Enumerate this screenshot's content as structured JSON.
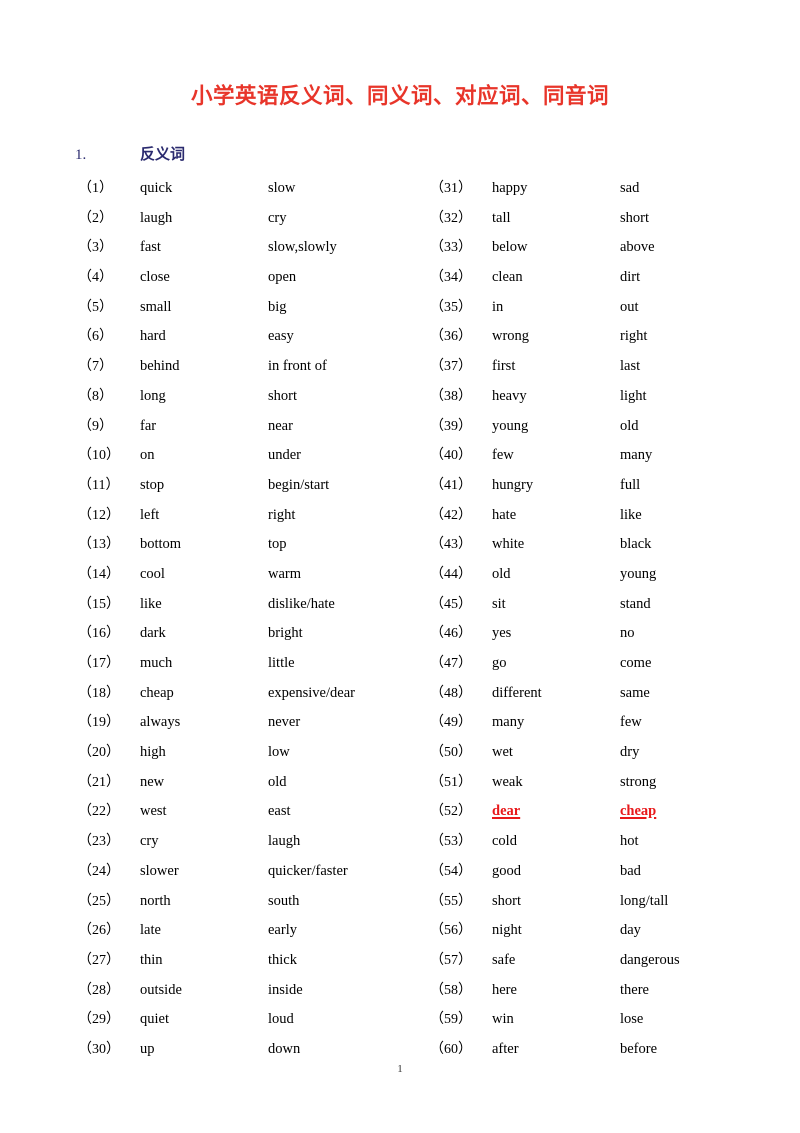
{
  "document": {
    "title": "小学英语反义词、同义词、对应词、同音词",
    "title_color": "#e8352a",
    "page_number": "1"
  },
  "section": {
    "number": "1.",
    "label": "反义词",
    "color": "#2a2a6e"
  },
  "highlight": {
    "color": "#e8191b"
  },
  "antonyms": {
    "left_column": [
      {
        "idx": "（1）",
        "word": "quick",
        "opposite": "slow"
      },
      {
        "idx": "（2）",
        "word": "laugh",
        "opposite": "cry"
      },
      {
        "idx": "（3）",
        "word": "fast",
        "opposite": "slow,slowly"
      },
      {
        "idx": "（4）",
        "word": "close",
        "opposite": "open"
      },
      {
        "idx": "（5）",
        "word": "small",
        "opposite": "big"
      },
      {
        "idx": "（6）",
        "word": "hard",
        "opposite": "easy"
      },
      {
        "idx": "（7）",
        "word": "behind",
        "opposite": "in front of"
      },
      {
        "idx": "（8）",
        "word": "long",
        "opposite": "short"
      },
      {
        "idx": "（9）",
        "word": "far",
        "opposite": "near"
      },
      {
        "idx": "（10）",
        "word": "on",
        "opposite": "under"
      },
      {
        "idx": "（11）",
        "word": "stop",
        "opposite": "begin/start"
      },
      {
        "idx": "（12）",
        "word": "left",
        "opposite": "right"
      },
      {
        "idx": "（13）",
        "word": "bottom",
        "opposite": "top"
      },
      {
        "idx": "（14）",
        "word": "cool",
        "opposite": "warm"
      },
      {
        "idx": "（15）",
        "word": "like",
        "opposite": "dislike/hate"
      },
      {
        "idx": "（16）",
        "word": "dark",
        "opposite": "bright"
      },
      {
        "idx": "（17）",
        "word": "much",
        "opposite": "little"
      },
      {
        "idx": "（18）",
        "word": "cheap",
        "opposite": "expensive/dear"
      },
      {
        "idx": "（19）",
        "word": "always",
        "opposite": "never"
      },
      {
        "idx": "（20）",
        "word": "high",
        "opposite": "low"
      },
      {
        "idx": "（21）",
        "word": "new",
        "opposite": "old"
      },
      {
        "idx": "（22）",
        "word": "west",
        "opposite": "east"
      },
      {
        "idx": "（23）",
        "word": "cry",
        "opposite": "laugh"
      },
      {
        "idx": "（24）",
        "word": "slower",
        "opposite": "quicker/faster"
      },
      {
        "idx": "（25）",
        "word": "north",
        "opposite": "south"
      },
      {
        "idx": "（26）",
        "word": "late",
        "opposite": "early"
      },
      {
        "idx": "（27）",
        "word": "thin",
        "opposite": "thick"
      },
      {
        "idx": "（28）",
        "word": "outside",
        "opposite": "inside"
      },
      {
        "idx": "（29）",
        "word": "quiet",
        "opposite": "loud"
      },
      {
        "idx": "（30）",
        "word": "up",
        "opposite": "down"
      }
    ],
    "right_column": [
      {
        "idx": "（31）",
        "word": "happy",
        "opposite": "sad"
      },
      {
        "idx": "（32）",
        "word": "tall",
        "opposite": "short"
      },
      {
        "idx": "（33）",
        "word": "below",
        "opposite": "above"
      },
      {
        "idx": "（34）",
        "word": "clean",
        "opposite": "dirt"
      },
      {
        "idx": "（35）",
        "word": "in",
        "opposite": "out"
      },
      {
        "idx": "（36）",
        "word": "wrong",
        "opposite": "right"
      },
      {
        "idx": "（37）",
        "word": "first",
        "opposite": "last"
      },
      {
        "idx": "（38）",
        "word": "heavy",
        "opposite": "light"
      },
      {
        "idx": "（39）",
        "word": "young",
        "opposite": "old"
      },
      {
        "idx": "（40）",
        "word": "few",
        "opposite": "many"
      },
      {
        "idx": "（41）",
        "word": "hungry",
        "opposite": "full"
      },
      {
        "idx": "（42）",
        "word": "hate",
        "opposite": "like"
      },
      {
        "idx": "（43）",
        "word": "white",
        "opposite": "black"
      },
      {
        "idx": "（44）",
        "word": "old",
        "opposite": "young"
      },
      {
        "idx": "（45）",
        "word": "sit",
        "opposite": "stand"
      },
      {
        "idx": "（46）",
        "word": "yes",
        "opposite": "no"
      },
      {
        "idx": "（47）",
        "word": "go",
        "opposite": "come"
      },
      {
        "idx": "（48）",
        "word": "different",
        "opposite": "same"
      },
      {
        "idx": "（49）",
        "word": "many",
        "opposite": "few"
      },
      {
        "idx": "（50）",
        "word": "wet",
        "opposite": "dry"
      },
      {
        "idx": "（51）",
        "word": "weak",
        "opposite": "strong"
      },
      {
        "idx": "（52）",
        "word": "dear",
        "opposite": "cheap",
        "highlight": true
      },
      {
        "idx": "（53）",
        "word": "cold",
        "opposite": "hot"
      },
      {
        "idx": "（54）",
        "word": "good",
        "opposite": "bad"
      },
      {
        "idx": "（55）",
        "word": "short",
        "opposite": "long/tall"
      },
      {
        "idx": "（56）",
        "word": "night",
        "opposite": "day"
      },
      {
        "idx": "（57）",
        "word": "safe",
        "opposite": "dangerous"
      },
      {
        "idx": "（58）",
        "word": "here",
        "opposite": "there"
      },
      {
        "idx": "（59）",
        "word": "win",
        "opposite": "lose"
      },
      {
        "idx": "（60）",
        "word": "after",
        "opposite": "before"
      }
    ]
  }
}
